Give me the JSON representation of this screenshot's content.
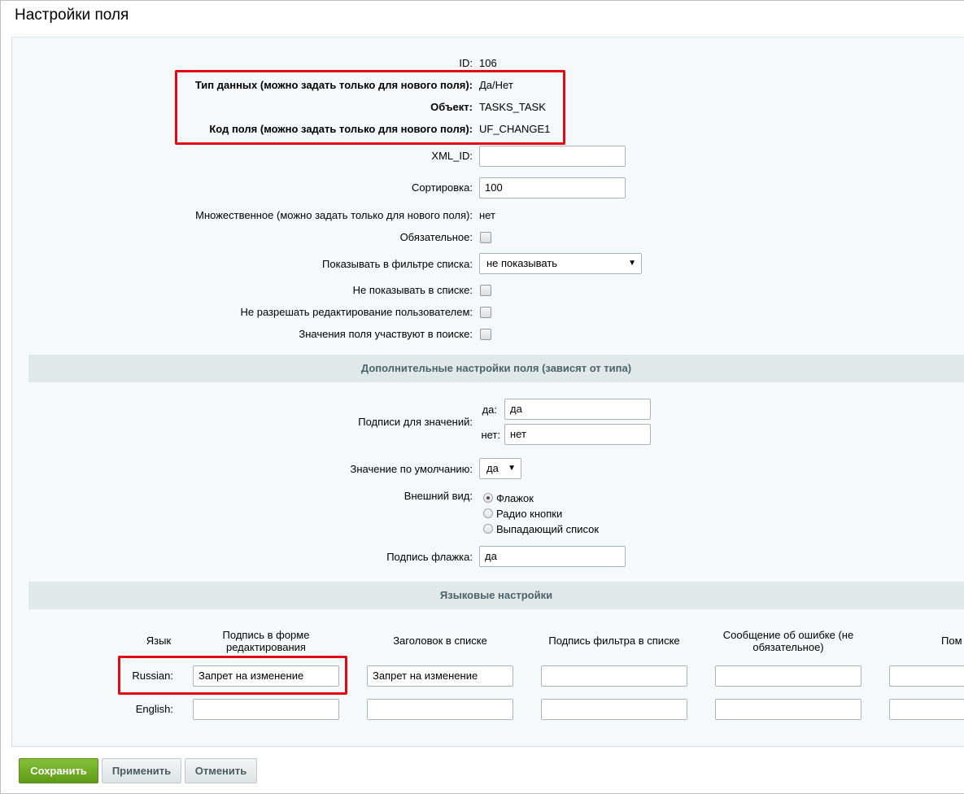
{
  "page_title": "Настройки поля",
  "main": {
    "id_label": "ID:",
    "id_value": "106",
    "type_label": "Тип данных (можно задать только для нового поля):",
    "type_value": "Да/Нет",
    "object_label": "Объект:",
    "object_value": "TASKS_TASK",
    "code_label": "Код поля (можно задать только для нового поля):",
    "code_value": "UF_CHANGE1",
    "xml_id_label": "XML_ID:",
    "xml_id_value": "",
    "sort_label": "Сортировка:",
    "sort_value": "100",
    "multiple_label": "Множественное (можно задать только для нового поля):",
    "multiple_value": "нет",
    "required_label": "Обязательное:",
    "required_checked": false,
    "filter_label": "Показывать в фильтре списка:",
    "filter_value": "не показывать",
    "hide_in_list_label": "Не показывать в списке:",
    "no_edit_label": "Не разрешать редактирование пользователем:",
    "searchable_label": "Значения поля участвуют в поиске:"
  },
  "extra": {
    "section_title": "Дополнительные настройки поля (зависят от типа)",
    "captions_label": "Подписи для значений:",
    "yes_label": "да:",
    "yes_value": "да",
    "no_label": "нет:",
    "no_value": "нет",
    "default_label": "Значение по умолчанию:",
    "default_value": "да",
    "view_label": "Внешний вид:",
    "view_options": [
      "Флажок",
      "Радио кнопки",
      "Выпадающий список"
    ],
    "view_selected": "Флажок",
    "checkbox_caption_label": "Подпись флажка:",
    "checkbox_caption_value": "да"
  },
  "lang": {
    "section_title": "Языковые настройки",
    "headers": {
      "language": "Язык",
      "edit_form": "Подпись в форме редактирования",
      "list_header": "Заголовок в списке",
      "filter": "Подпись фильтра в списке",
      "error": "Сообщение об ошибке (не обязательное)",
      "help": "Пом"
    },
    "rows": [
      {
        "name": "Russian:",
        "edit_form": "Запрет на изменение",
        "list_header": "Запрет на изменение",
        "filter": "",
        "error": "",
        "help": ""
      },
      {
        "name": "English:",
        "edit_form": "",
        "list_header": "",
        "filter": "",
        "error": "",
        "help": ""
      }
    ]
  },
  "buttons": {
    "save": "Сохранить",
    "apply": "Применить",
    "cancel": "Отменить"
  },
  "colors": {
    "highlight": "#e30613",
    "save_button": "#6aa91f",
    "section_bar": "#e0e8ea"
  }
}
